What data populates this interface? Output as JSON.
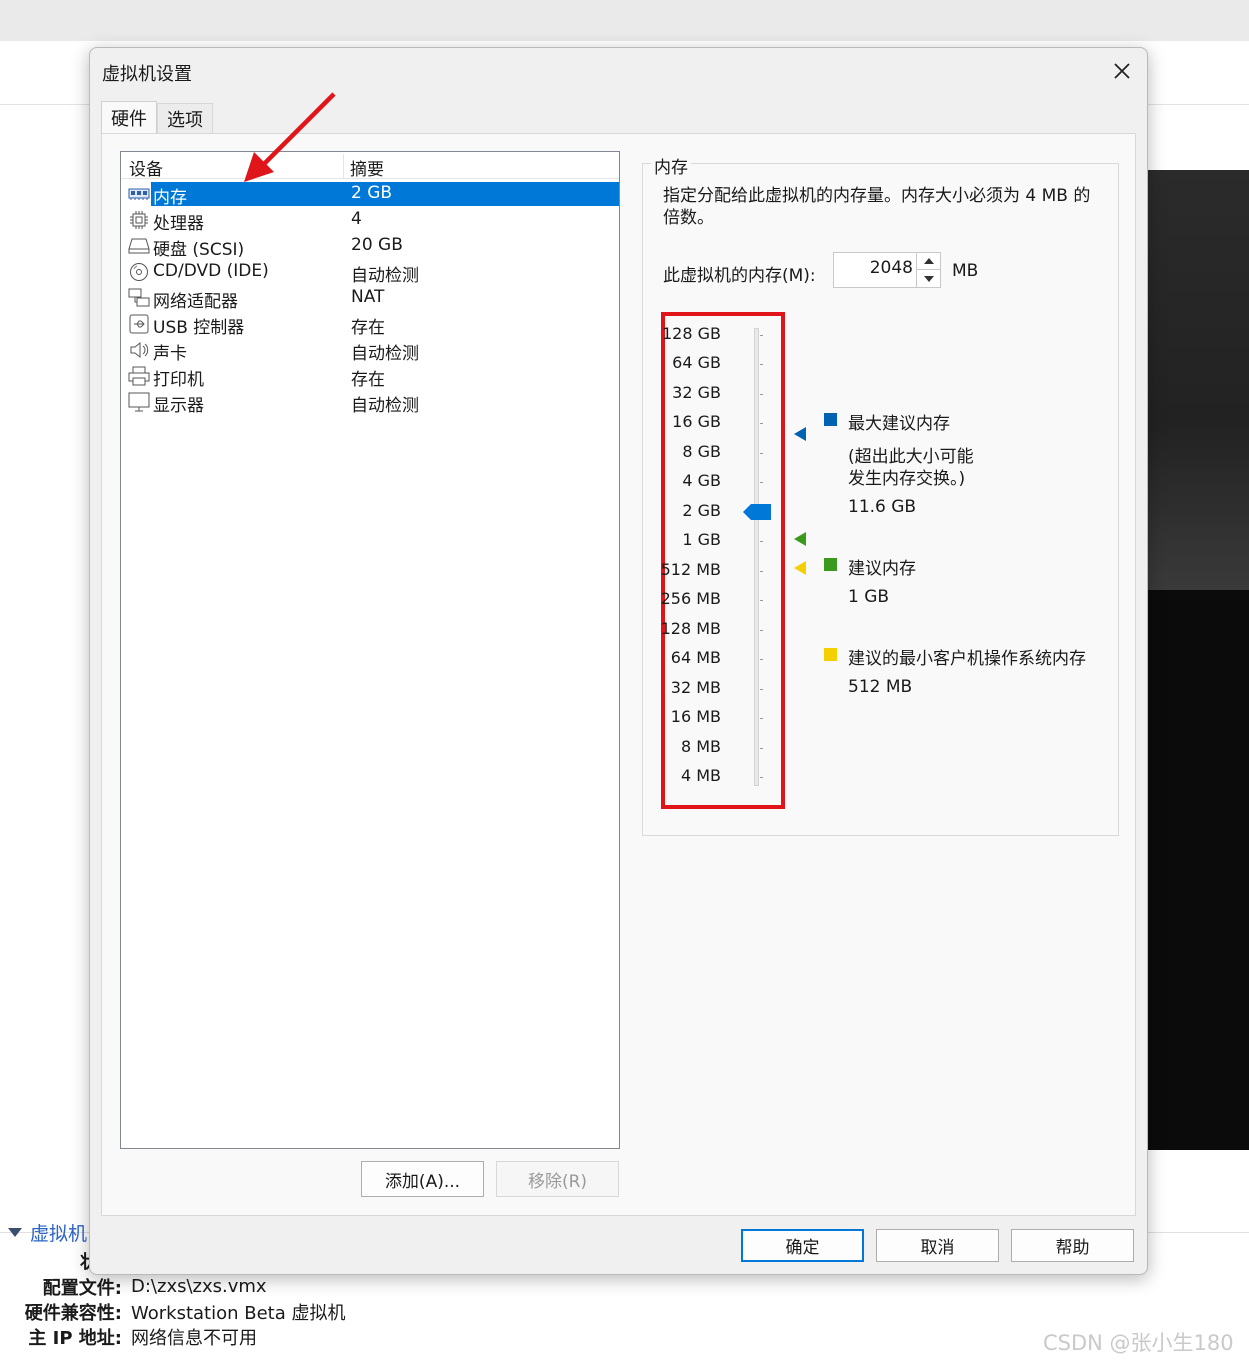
{
  "dialog": {
    "title": "虚拟机设置",
    "tabs": [
      {
        "label": "硬件",
        "active": true
      },
      {
        "label": "选项",
        "active": false
      }
    ]
  },
  "device_list": {
    "columns": [
      "设备",
      "摘要"
    ],
    "rows": [
      {
        "icon": "memory-icon",
        "name": "内存",
        "summary": "2 GB",
        "selected": true
      },
      {
        "icon": "processor-icon",
        "name": "处理器",
        "summary": "4",
        "selected": false
      },
      {
        "icon": "harddisk-icon",
        "name": "硬盘 (SCSI)",
        "summary": "20 GB",
        "selected": false
      },
      {
        "icon": "cd-dvd-icon",
        "name": "CD/DVD (IDE)",
        "summary": "自动检测",
        "selected": false
      },
      {
        "icon": "network-adapter-icon",
        "name": "网络适配器",
        "summary": "NAT",
        "selected": false
      },
      {
        "icon": "usb-controller-icon",
        "name": "USB 控制器",
        "summary": "存在",
        "selected": false
      },
      {
        "icon": "sound-card-icon",
        "name": "声卡",
        "summary": "自动检测",
        "selected": false
      },
      {
        "icon": "printer-icon",
        "name": "打印机",
        "summary": "存在",
        "selected": false
      },
      {
        "icon": "display-icon",
        "name": "显示器",
        "summary": "自动检测",
        "selected": false
      }
    ],
    "add_button": "添加(A)...",
    "remove_button": "移除(R)"
  },
  "memory": {
    "group_title": "内存",
    "description": "指定分配给此虚拟机的内存量。内存大小必须为 4 MB 的倍数。",
    "field_label": "此虚拟机的内存(M):",
    "value": "2048",
    "unit": "MB",
    "scale_labels": [
      "128 GB",
      "64 GB",
      "32 GB",
      "16 GB",
      "8 GB",
      "4 GB",
      "2 GB",
      "1 GB",
      "512 MB",
      "256 MB",
      "128 MB",
      "64 MB",
      "32 MB",
      "16 MB",
      "8 MB",
      "4 MB"
    ],
    "slider_value": "2 GB",
    "legend": {
      "max_recommended": {
        "title": "最大建议内存",
        "note_line1": "(超出此大小可能",
        "note_line2": "发生内存交换。)",
        "value": "11.6 GB",
        "color": "#0063b1"
      },
      "recommended": {
        "title": "建议内存",
        "value": "1 GB",
        "color": "#3a9a1e"
      },
      "guest_min": {
        "title": "建议的最小客户机操作系统内存",
        "value": "512 MB",
        "color": "#f5d000"
      }
    }
  },
  "footer": {
    "ok": "确定",
    "cancel": "取消",
    "help": "帮助"
  },
  "background": {
    "section_title": "虚拟机",
    "stub_glyph": "状",
    "info": [
      {
        "key": "配置文件:",
        "value": "D:\\zxs\\zxs.vmx"
      },
      {
        "key": "硬件兼容性:",
        "value": "Workstation Beta 虚拟机"
      },
      {
        "key": "主 IP 地址:",
        "value": "网络信息不可用"
      }
    ],
    "watermark": "CSDN @张小生180"
  },
  "annotation": {
    "highlight_color": "#e0151a"
  }
}
